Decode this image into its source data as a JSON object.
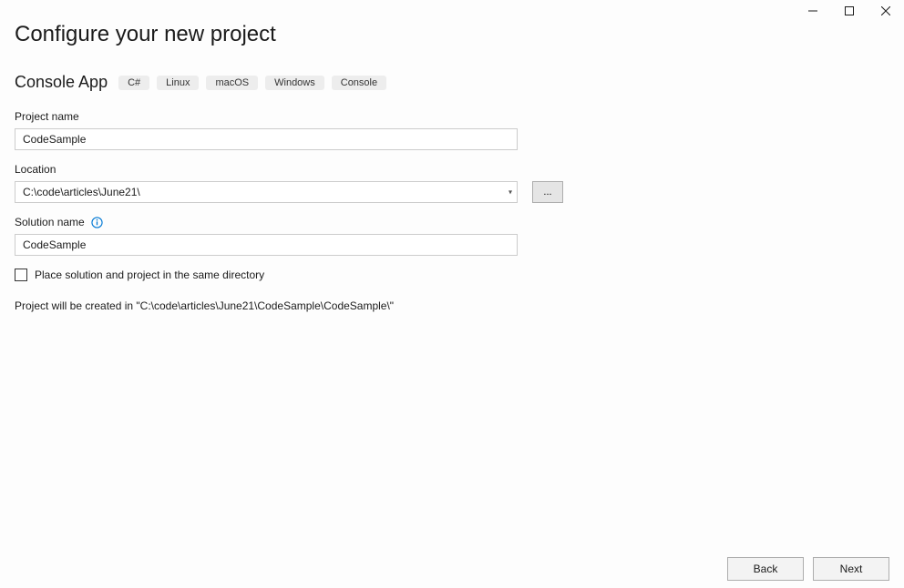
{
  "window": {
    "title": "Configure your new project",
    "subtitle": "Console App",
    "tags": [
      "C#",
      "Linux",
      "macOS",
      "Windows",
      "Console"
    ]
  },
  "form": {
    "project_name_label": "Project name",
    "project_name_value": "CodeSample",
    "location_label": "Location",
    "location_value": "C:\\code\\articles\\June21\\",
    "browse_label": "...",
    "solution_name_label": "Solution name",
    "solution_name_value": "CodeSample",
    "same_dir_label": "Place solution and project in the same directory",
    "same_dir_checked": false,
    "path_preview": "Project will be created in \"C:\\code\\articles\\June21\\CodeSample\\CodeSample\\\""
  },
  "footer": {
    "back_label": "Back",
    "next_label": "Next"
  }
}
